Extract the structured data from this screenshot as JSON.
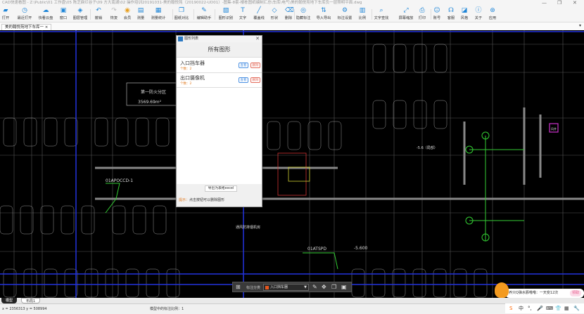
{
  "window": {
    "title": "CAD快速看图 - Z:\\Public\\01 工作盘\\05 陈芝麻烂谷子\\09 方大南湖\\02 操作培训20191031-美的翰悦苑（20190022-UD01）-图集-8套-楼栋图纸编制汇总\\车库\\电气\\美的翰悦苑地下车库负一层照明平面.dwg",
    "minimize": "—",
    "maximize": "❐",
    "close": "✕"
  },
  "toolbar": [
    {
      "label": "打开",
      "icon": "folder-icon"
    },
    {
      "label": "最近打开",
      "icon": "clock-icon"
    },
    {
      "label": "快看云盘",
      "icon": "cloud-icon"
    },
    {
      "label": "窗口",
      "icon": "window-icon"
    },
    {
      "label": "图层管理",
      "icon": "layers-icon"
    },
    {
      "label": "撤销",
      "icon": "undo-icon"
    },
    {
      "label": "恢复",
      "icon": "redo-icon"
    },
    {
      "label": "会员",
      "icon": "vip-icon"
    },
    {
      "label": "测量",
      "icon": "ruler-icon"
    },
    {
      "label": "测量统计",
      "icon": "stats-icon"
    },
    {
      "label": "图纸对比",
      "icon": "compare-icon"
    },
    {
      "label": "编辑助手",
      "icon": "edit-icon"
    },
    {
      "label": "图形识别",
      "icon": "recognize-icon"
    },
    {
      "label": "文字",
      "icon": "text-icon"
    },
    {
      "label": "覆盖线",
      "icon": "line-icon"
    },
    {
      "label": "形状",
      "icon": "shape-icon"
    },
    {
      "label": "删除",
      "icon": "eraser-icon"
    },
    {
      "label": "隐藏标注",
      "icon": "eye-off-icon"
    },
    {
      "label": "导入导出",
      "icon": "import-export-icon"
    },
    {
      "label": "标注设置",
      "icon": "annotation-settings-icon"
    },
    {
      "label": "比例",
      "icon": "scale-icon"
    },
    {
      "label": "文字查找",
      "icon": "text-search-icon"
    },
    {
      "label": "屏幕缩放",
      "icon": "zoom-screen-icon"
    },
    {
      "label": "打印",
      "icon": "printer-icon"
    },
    {
      "label": "账号",
      "icon": "user-icon"
    },
    {
      "label": "客服",
      "icon": "headset-icon"
    },
    {
      "label": "风格",
      "icon": "style-icon"
    },
    {
      "label": "关于",
      "icon": "info-icon"
    },
    {
      "label": "应用",
      "icon": "apps-icon"
    }
  ],
  "tabs": {
    "active": "美的翰悦苑地下车库一",
    "close": "×"
  },
  "drawing": {
    "labels": [
      "第一防火分区",
      "3569.69m²",
      "01APOCCD-1",
      "01ATSPD",
      "-5.600",
      "-5.6（局部）",
      "通风防排烟机房",
      "风井"
    ]
  },
  "dialog": {
    "title": "图形列表",
    "close": "✕",
    "heading": "所有图形",
    "items": [
      {
        "name": "入口挡车器",
        "count": "个数：2",
        "view": "查看",
        "delete": "删除"
      },
      {
        "name": "出口摄像机",
        "count": "个数：2",
        "view": "查看",
        "delete": "删除"
      }
    ],
    "export": "导出为表格excel",
    "tip_label": "提示：",
    "tip": "点击按钮可以删除图形"
  },
  "floatbar": {
    "label": "标注分类",
    "selected": "入口挡车器",
    "swatch": "#e8561c"
  },
  "layout_tabs": [
    "模型",
    "布局1"
  ],
  "status": {
    "coords": "x = 2356313  y = 508994",
    "scale": "模型中的标注比例：1"
  },
  "notification": {
    "text": "养只Q弹水豚噜噜：一天变12次",
    "button": "领取"
  },
  "ime": [
    "S",
    "中",
    "°,",
    "🎤",
    "⌨",
    "👕",
    "▦",
    "🔧"
  ],
  "colors": {
    "accent": "#1f86d8",
    "canvas": "#000000",
    "delete": "#e36c5c"
  }
}
